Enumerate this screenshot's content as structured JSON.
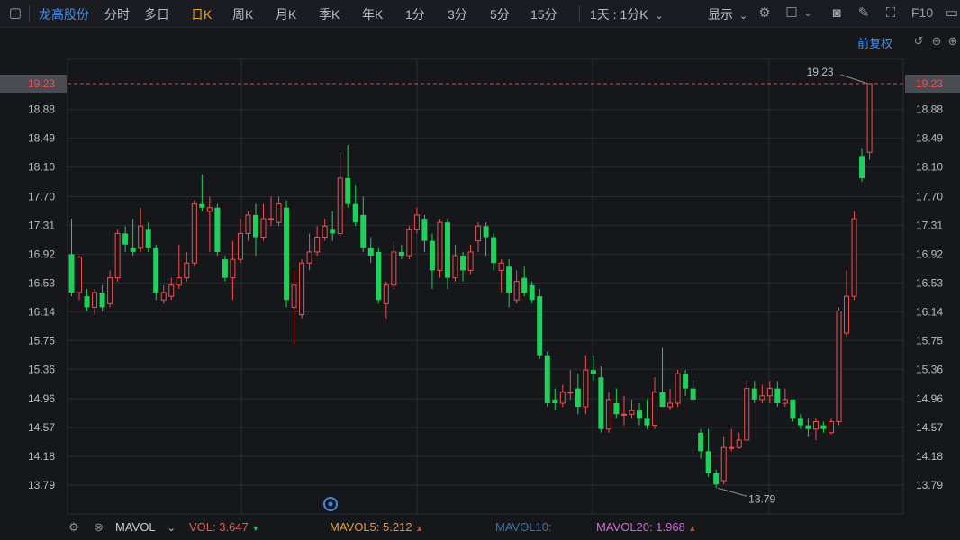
{
  "toolbar": {
    "stock_name": "龙高股份",
    "periods": [
      "分时",
      "多日",
      "日K",
      "周K",
      "月K",
      "季K",
      "年K",
      "1分",
      "3分",
      "5分",
      "15分"
    ],
    "active_period": "日K",
    "multi_label": "1天 : 1分K",
    "display_label": "显示",
    "f10_label": "F10"
  },
  "chart_header": {
    "adjust_label": "前复权"
  },
  "chart_data": {
    "type": "candlestick",
    "y_ticks": [
      "19.23",
      "18.88",
      "18.49",
      "18.10",
      "17.70",
      "17.31",
      "16.92",
      "16.53",
      "16.14",
      "15.75",
      "15.36",
      "14.96",
      "14.57",
      "14.18",
      "13.79"
    ],
    "ylim": [
      13.79,
      19.23
    ],
    "grid": true,
    "last_price_label": "19.23",
    "max_label": "19.23",
    "min_label": "13.79",
    "candles": [
      [
        16.92,
        16.4,
        17.4,
        16.35
      ],
      [
        16.4,
        16.88,
        16.9,
        16.3
      ],
      [
        16.35,
        16.2,
        16.45,
        16.15
      ],
      [
        16.2,
        16.4,
        16.45,
        16.1
      ],
      [
        16.4,
        16.2,
        16.5,
        16.15
      ],
      [
        16.25,
        16.6,
        16.7,
        16.2
      ],
      [
        16.6,
        17.2,
        17.25,
        16.55
      ],
      [
        17.2,
        17.05,
        17.3,
        16.95
      ],
      [
        17.0,
        16.95,
        17.4,
        16.9
      ],
      [
        17.0,
        17.3,
        17.55,
        16.95
      ],
      [
        17.25,
        17.0,
        17.35,
        16.95
      ],
      [
        17.0,
        16.4,
        17.05,
        16.3
      ],
      [
        16.3,
        16.4,
        16.5,
        16.25
      ],
      [
        16.35,
        16.5,
        16.6,
        16.3
      ],
      [
        16.5,
        16.6,
        17.05,
        16.45
      ],
      [
        16.6,
        16.8,
        16.95,
        16.55
      ],
      [
        16.8,
        17.6,
        17.65,
        16.75
      ],
      [
        17.6,
        17.55,
        18.0,
        17.5
      ],
      [
        17.5,
        17.55,
        17.7,
        16.95
      ],
      [
        17.55,
        16.95,
        17.6,
        16.9
      ],
      [
        16.85,
        16.6,
        16.9,
        16.55
      ],
      [
        16.6,
        16.85,
        17.1,
        16.3
      ],
      [
        16.85,
        17.2,
        17.4,
        16.8
      ],
      [
        17.2,
        17.45,
        17.5,
        17.1
      ],
      [
        17.45,
        17.15,
        17.6,
        16.9
      ],
      [
        17.15,
        17.4,
        17.6,
        17.1
      ],
      [
        17.4,
        17.4,
        17.7,
        17.3
      ],
      [
        17.35,
        17.6,
        17.7,
        17.3
      ],
      [
        17.55,
        16.3,
        17.65,
        16.2
      ],
      [
        16.2,
        16.5,
        16.7,
        15.7
      ],
      [
        16.1,
        16.8,
        16.85,
        16.05
      ],
      [
        16.8,
        16.95,
        17.2,
        16.7
      ],
      [
        16.95,
        17.15,
        17.3,
        16.9
      ],
      [
        17.15,
        17.3,
        17.4,
        17.1
      ],
      [
        17.25,
        17.2,
        17.5,
        17.1
      ],
      [
        17.2,
        17.95,
        18.3,
        17.15
      ],
      [
        17.95,
        17.6,
        18.4,
        17.55
      ],
      [
        17.6,
        17.35,
        17.85,
        17.3
      ],
      [
        17.45,
        17.0,
        17.7,
        16.95
      ],
      [
        17.0,
        16.9,
        17.15,
        16.8
      ],
      [
        16.95,
        16.3,
        17.0,
        16.25
      ],
      [
        16.25,
        16.5,
        16.55,
        16.05
      ],
      [
        16.5,
        16.95,
        17.1,
        16.45
      ],
      [
        16.95,
        16.9,
        17.05,
        16.85
      ],
      [
        16.9,
        17.25,
        17.3,
        16.85
      ],
      [
        17.25,
        17.45,
        17.55,
        17.2
      ],
      [
        17.4,
        17.1,
        17.45,
        16.95
      ],
      [
        17.1,
        16.7,
        17.2,
        16.45
      ],
      [
        16.7,
        17.35,
        17.4,
        16.6
      ],
      [
        17.35,
        16.6,
        17.4,
        16.45
      ],
      [
        16.6,
        16.9,
        17.05,
        16.55
      ],
      [
        16.9,
        16.7,
        16.95,
        16.55
      ],
      [
        16.7,
        16.95,
        17.05,
        16.65
      ],
      [
        17.1,
        17.3,
        17.35,
        16.95
      ],
      [
        17.3,
        17.15,
        17.35,
        16.9
      ],
      [
        17.15,
        16.8,
        17.2,
        16.7
      ],
      [
        16.7,
        16.8,
        16.85,
        16.4
      ],
      [
        16.75,
        16.4,
        16.85,
        16.2
      ],
      [
        16.3,
        16.55,
        16.7,
        16.25
      ],
      [
        16.6,
        16.4,
        16.75,
        16.35
      ],
      [
        16.5,
        16.3,
        16.55,
        16.25
      ],
      [
        16.35,
        15.55,
        16.45,
        15.5
      ],
      [
        15.55,
        14.9,
        15.6,
        14.85
      ],
      [
        14.95,
        14.9,
        15.1,
        14.8
      ],
      [
        14.9,
        15.05,
        15.15,
        14.85
      ],
      [
        15.05,
        15.05,
        15.35,
        14.95
      ],
      [
        15.1,
        14.85,
        15.3,
        14.75
      ],
      [
        14.85,
        15.35,
        15.55,
        14.75
      ],
      [
        15.35,
        15.3,
        15.55,
        15.2
      ],
      [
        15.25,
        14.55,
        15.4,
        14.5
      ],
      [
        14.55,
        14.95,
        15.05,
        14.5
      ],
      [
        14.9,
        14.75,
        15.1,
        14.7
      ],
      [
        14.75,
        14.75,
        15.0,
        14.6
      ],
      [
        14.75,
        14.8,
        14.95,
        14.7
      ],
      [
        14.8,
        14.7,
        14.9,
        14.6
      ],
      [
        14.7,
        14.6,
        14.95,
        14.55
      ],
      [
        14.6,
        15.05,
        15.25,
        14.55
      ],
      [
        15.05,
        14.85,
        15.65,
        14.85
      ],
      [
        14.85,
        14.9,
        15.1,
        14.8
      ],
      [
        14.9,
        15.3,
        15.35,
        14.85
      ],
      [
        15.3,
        15.1,
        15.35,
        15.0
      ],
      [
        15.1,
        14.95,
        15.2,
        14.9
      ],
      [
        14.5,
        14.25,
        14.55,
        14.15
      ],
      [
        14.25,
        13.95,
        14.55,
        13.9
      ],
      [
        13.95,
        13.8,
        14.0,
        13.75
      ],
      [
        13.85,
        14.3,
        14.45,
        13.8
      ],
      [
        14.3,
        14.3,
        14.55,
        14.25
      ],
      [
        14.3,
        14.4,
        14.5,
        14.28
      ],
      [
        14.4,
        15.1,
        15.2,
        14.4
      ],
      [
        15.1,
        14.95,
        15.2,
        14.9
      ],
      [
        14.95,
        15.0,
        15.15,
        14.9
      ],
      [
        15.0,
        15.1,
        15.2,
        14.9
      ],
      [
        15.1,
        14.9,
        15.2,
        14.85
      ],
      [
        14.9,
        14.95,
        15.1,
        14.85
      ],
      [
        14.95,
        14.7,
        14.95,
        14.65
      ],
      [
        14.7,
        14.6,
        14.75,
        14.55
      ],
      [
        14.6,
        14.55,
        14.7,
        14.45
      ],
      [
        14.55,
        14.65,
        14.7,
        14.4
      ],
      [
        14.6,
        14.55,
        14.65,
        14.5
      ],
      [
        14.5,
        14.65,
        14.7,
        14.48
      ],
      [
        14.65,
        16.15,
        16.2,
        14.6
      ],
      [
        15.85,
        16.35,
        16.7,
        15.8
      ],
      [
        16.35,
        17.4,
        17.5,
        16.3
      ],
      [
        18.25,
        17.95,
        18.35,
        17.9
      ],
      [
        18.3,
        19.23,
        19.23,
        18.2
      ]
    ],
    "colors": {
      "up": "#ef4f4f",
      "down": "#1fd15a",
      "grid": "#2a2c31",
      "axis_text": "#b9bcc4",
      "hl_line": "#d15050",
      "hl_bg": "#4a4c54"
    }
  },
  "indicator": {
    "name": "MAVOL",
    "vol_label": "VOL:",
    "vol_value": "3.647",
    "mavol5_label": "MAVOL5:",
    "mavol5_value": "5.212",
    "mavol10_label": "MAVOL10:",
    "mavol20_label": "MAVOL20:",
    "mavol20_value": "1.968",
    "colors": {
      "vol": "#e85c4a",
      "mavol5": "#e89a3c",
      "mavol10": "#3c74a8",
      "mavol20": "#d06cd0",
      "up": "#e04040",
      "down": "#1fc15a"
    }
  }
}
